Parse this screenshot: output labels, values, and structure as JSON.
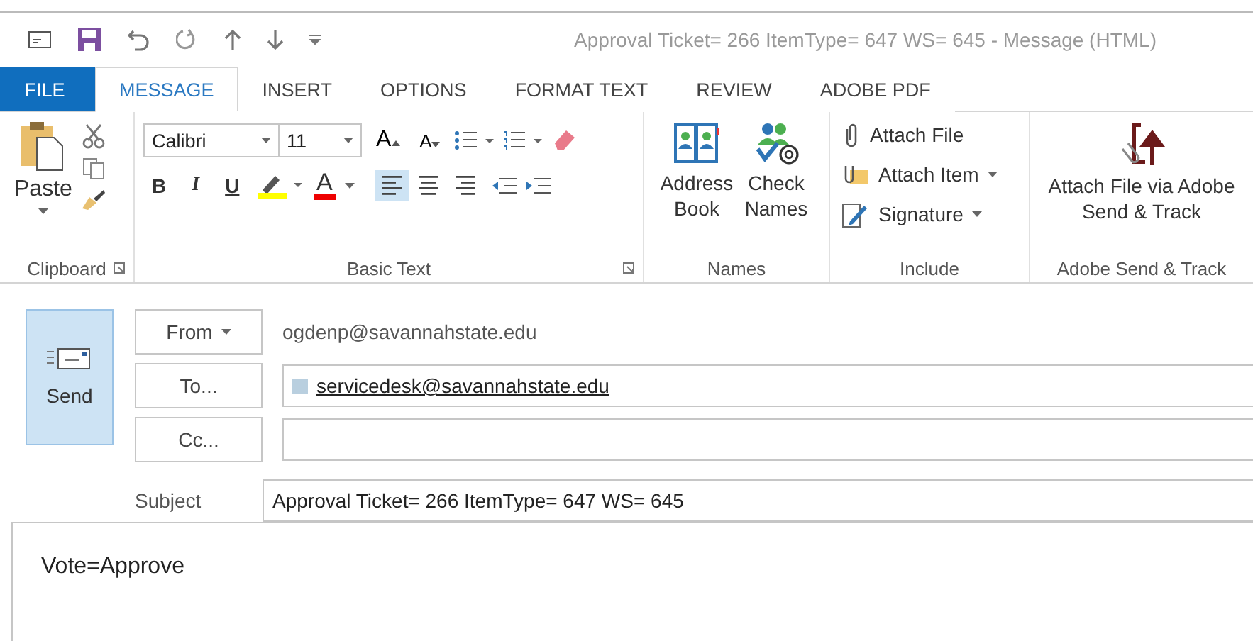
{
  "window": {
    "title": "Approval Ticket= 266 ItemType= 647 WS= 645 - Message (HTML)"
  },
  "tabs": [
    {
      "label": "FILE",
      "kind": "file",
      "selected": false
    },
    {
      "label": "MESSAGE",
      "kind": "tab",
      "selected": true
    },
    {
      "label": "INSERT",
      "kind": "tab",
      "selected": false
    },
    {
      "label": "OPTIONS",
      "kind": "tab",
      "selected": false
    },
    {
      "label": "FORMAT TEXT",
      "kind": "tab",
      "selected": false
    },
    {
      "label": "REVIEW",
      "kind": "tab",
      "selected": false
    },
    {
      "label": "ADOBE PDF",
      "kind": "tab",
      "selected": false
    }
  ],
  "ribbon": {
    "clipboard": {
      "paste": "Paste",
      "label": "Clipboard"
    },
    "basic_text": {
      "font_name": "Calibri",
      "font_size": "11",
      "grow_font": "A",
      "shrink_font": "A",
      "format_buttons": [
        {
          "label": "B",
          "kind": "bold"
        },
        {
          "label": "I",
          "kind": "italic"
        },
        {
          "label": "U",
          "kind": "underline"
        }
      ],
      "font_color": "A",
      "alignment": [
        {
          "kind": "left",
          "selected": true
        },
        {
          "kind": "center",
          "selected": false
        },
        {
          "kind": "right",
          "selected": false
        }
      ],
      "label": "Basic Text"
    },
    "names": {
      "buttons": [
        {
          "label": "Address Book",
          "kind": "address"
        },
        {
          "label": "Check Names",
          "kind": "check"
        }
      ],
      "label": "Names"
    },
    "include": {
      "items": [
        {
          "label": "Attach File",
          "kind": "file",
          "dropdown": false
        },
        {
          "label": "Attach Item",
          "kind": "item",
          "dropdown": true
        },
        {
          "label": "Signature",
          "kind": "signature",
          "dropdown": true
        }
      ],
      "label": "Include"
    },
    "adobe": {
      "button": "Attach File via Adobe Send & Track",
      "label": "Adobe Send & Track"
    }
  },
  "compose": {
    "send": "Send",
    "from": {
      "button": "From",
      "dropdown": true,
      "value": "ogdenp@savannahstate.edu"
    },
    "to": {
      "button": "To...",
      "recipients": [
        "servicedesk@savannahstate.edu"
      ]
    },
    "cc": {
      "button": "Cc..."
    },
    "subject": {
      "label": "Subject",
      "value": "Approval Ticket= 266 ItemType= 647 WS= 645"
    },
    "body": "Vote=Approve"
  }
}
